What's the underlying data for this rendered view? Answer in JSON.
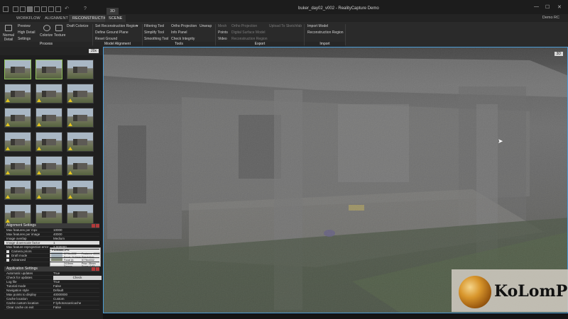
{
  "window": {
    "title": "buker_day02_v002 - RealityCapture Demo",
    "demo_label": "Demo RC",
    "min_icon": "minimize-icon",
    "max_icon": "maximize-icon",
    "close_icon": "close-icon"
  },
  "tabs": [
    {
      "label": "WORKFLOW"
    },
    {
      "label": "ALIGNMENT"
    },
    {
      "label": "RECONSTRUCTION"
    },
    {
      "label": "SCENE"
    }
  ],
  "layout_badge": "3D",
  "ribbon": {
    "process": {
      "label": "Process",
      "normal_detail": "Normal Detail",
      "preview": "Preview",
      "high_detail": "High Detail",
      "settings": "Settings",
      "colorize": "Colorize",
      "texture": "Texture",
      "draft_colorize": "Draft Colorize"
    },
    "model_alignment": {
      "label": "Model Alignment",
      "set_region": "Set Reconstruction Region",
      "define_ground": "Define Ground Plane",
      "reset_ground": "Reset Ground"
    },
    "tools": {
      "label": "Tools",
      "filtering": "Filtering Tool",
      "simplify": "Simplify Tool",
      "smoothing": "Smoothing Tool",
      "ortho": "Ortho Projection",
      "info": "Info Panel",
      "integrity": "Check Integrity",
      "unwrap": "Unwrap"
    },
    "export": {
      "label": "Export",
      "mesh": "Mesh",
      "points": "Points",
      "video": "Video",
      "ortho": "Ortho Projection",
      "dsm": "Digital Surface Model",
      "region": "Reconstruction Region",
      "sketchfab": "Upload To Sketchfab"
    },
    "import": {
      "label": "Import",
      "model": "Import Model",
      "region": "Reconstruction Region"
    }
  },
  "images_panel": {
    "count": "20x",
    "thumbnails": [
      {
        "selected": true,
        "warning": false
      },
      {
        "selected": true,
        "warning": false
      },
      {
        "selected": false,
        "warning": false
      },
      {
        "selected": false,
        "warning": true
      },
      {
        "selected": false,
        "warning": true
      },
      {
        "selected": false,
        "warning": true
      },
      {
        "selected": false,
        "warning": true
      },
      {
        "selected": false,
        "warning": true
      },
      {
        "selected": false,
        "warning": true
      },
      {
        "selected": false,
        "warning": true
      },
      {
        "selected": false,
        "warning": true
      },
      {
        "selected": false,
        "warning": true
      },
      {
        "selected": false,
        "warning": true
      },
      {
        "selected": false,
        "warning": true
      },
      {
        "selected": false,
        "warning": true
      },
      {
        "selected": false,
        "warning": true
      },
      {
        "selected": false,
        "warning": true
      },
      {
        "selected": false,
        "warning": true
      },
      {
        "selected": false,
        "warning": true
      },
      {
        "selected": false,
        "warning": false
      },
      {
        "selected": false,
        "warning": false
      }
    ],
    "tooltip": {
      "filename": "P1050885.JPG",
      "line1": "5776x4332",
      "line2": "Focal: 24.6mm",
      "line3": "Focal (r): 24.6mm",
      "line4": "Sensor: 17.3mm",
      "line5": "Features: 40000",
      "line6": "Resolution: 5776x4332",
      "line7": "Prior: 36mm",
      "line8": "Score: 0.83"
    }
  },
  "alignment_settings": {
    "title": "Alignment Settings",
    "rows": [
      {
        "key": "Max features per mpx",
        "value": "10000"
      },
      {
        "key": "Max features per image",
        "value": "40000"
      },
      {
        "key": "Image overlap",
        "value": "Medium"
      },
      {
        "key": "Image downscale factor",
        "value": "1"
      },
      {
        "key": "Max feature reprojection error",
        "value": "2.000000"
      }
    ],
    "checks": [
      {
        "label": "Camera priors"
      },
      {
        "label": "Draft mode"
      },
      {
        "label": "Advanced"
      }
    ]
  },
  "application_settings": {
    "title": "Application Settings",
    "rows": [
      {
        "key": "Automatic updates",
        "value": "True"
      },
      {
        "key": "Check for updates",
        "value": "Check"
      },
      {
        "key": "Log file",
        "value": "True"
      },
      {
        "key": "Tutorial mode",
        "value": "False"
      },
      {
        "key": "Navigation style",
        "value": "Default"
      },
      {
        "key": "Max points to display",
        "value": "40000000"
      },
      {
        "key": "Cache location",
        "value": "Custom"
      },
      {
        "key": "Cache custom location",
        "value": "F:\\photoscan\\cache"
      },
      {
        "key": "Clear cache on exit",
        "value": "False"
      }
    ]
  },
  "watermark": {
    "text": "KoLomPC"
  }
}
